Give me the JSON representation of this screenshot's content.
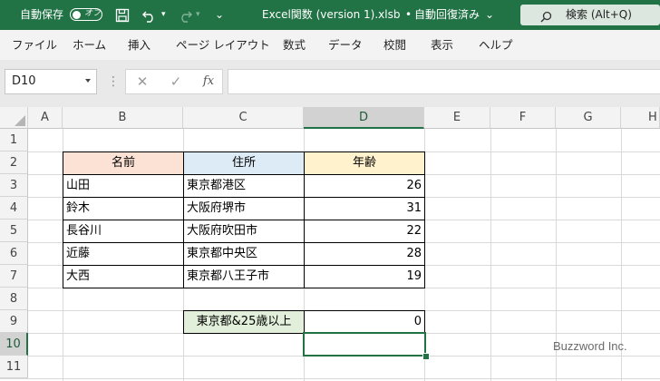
{
  "titlebar": {
    "autosave_label": "自動保存",
    "autosave_state": "オフ",
    "quick_access_more": "⌄",
    "file_title": "Excel関数 (version 1).xlsb",
    "separator": "•",
    "save_status": "自動回復済み",
    "save_status_chevron": "⌄",
    "search_label": "検索 (Alt+Q)"
  },
  "menu": {
    "items": [
      "ファイル",
      "ホーム",
      "挿入",
      "ページ レイアウト",
      "数式",
      "データ",
      "校閲",
      "表示",
      "ヘルプ"
    ]
  },
  "formula_bar": {
    "name_box": "D10",
    "fx": "fx",
    "formula": ""
  },
  "sheet": {
    "columns": [
      "A",
      "B",
      "C",
      "D",
      "E",
      "F",
      "G",
      "H"
    ],
    "rows": [
      "1",
      "2",
      "3",
      "4",
      "5",
      "6",
      "7",
      "8",
      "9",
      "10",
      "11"
    ],
    "selected_cell": "D10",
    "headers": {
      "name": "名前",
      "address": "住所",
      "age": "年齢"
    },
    "header_colors": {
      "name": "#fbe2d5",
      "address": "#ddebf7",
      "age": "#fff2cc"
    },
    "records": [
      {
        "name": "山田",
        "address": "東京都港区",
        "age": "26"
      },
      {
        "name": "鈴木",
        "address": "大阪府堺市",
        "age": "31"
      },
      {
        "name": "長谷川",
        "address": "大阪府吹田市",
        "age": "22"
      },
      {
        "name": "近藤",
        "address": "東京都中央区",
        "age": "28"
      },
      {
        "name": "大西",
        "address": "東京都八王子市",
        "age": "19"
      }
    ],
    "condition_label": "東京都&25歳以上",
    "condition_label_color": "#e2efda",
    "result": "0"
  },
  "watermark": "Buzzword Inc.",
  "colors": {
    "accent": "#217346",
    "selection": "#217346"
  }
}
